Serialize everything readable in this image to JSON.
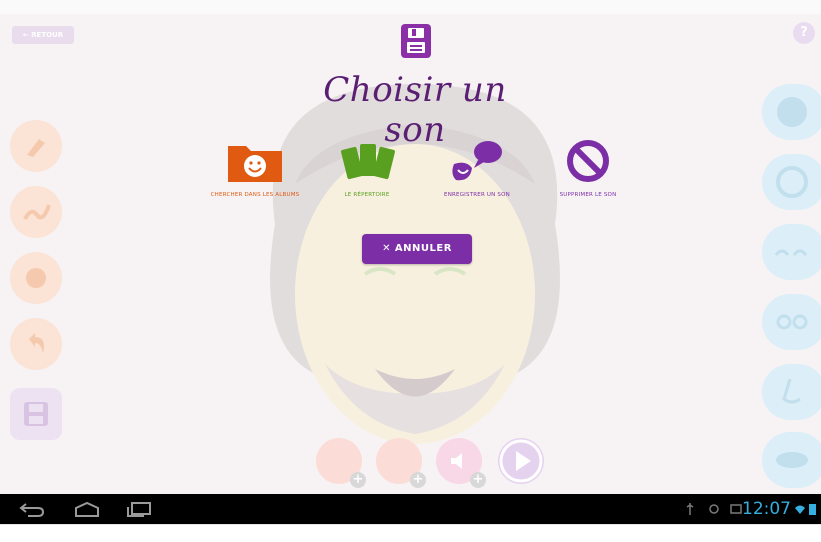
{
  "header": {
    "back_label": "← RETOUR",
    "help_label": "?"
  },
  "dialog": {
    "title": "Choisir un son",
    "options": [
      {
        "id": "albums",
        "label": "CHERCHER DANS LES ALBUMS",
        "icon": "folder-smiley-icon",
        "color": "#e05a12"
      },
      {
        "id": "repertoire",
        "label": "LE RÉPERTOIRE",
        "icon": "cards-icon",
        "color": "#5aa020"
      },
      {
        "id": "record",
        "label": "ENREGISTRER UN SON",
        "icon": "speech-record-icon",
        "color": "#7b2ea6"
      },
      {
        "id": "delete",
        "label": "SUPPRIMER LE SON",
        "icon": "prohibited-icon",
        "color": "#7b2ea6"
      }
    ],
    "cancel_label": "✕ ANNULER"
  },
  "statusbar": {
    "time": "12:07"
  },
  "colors": {
    "accent": "#7b2ea6",
    "orange": "#e05a12",
    "green": "#5aa020",
    "clock": "#36aee0"
  }
}
